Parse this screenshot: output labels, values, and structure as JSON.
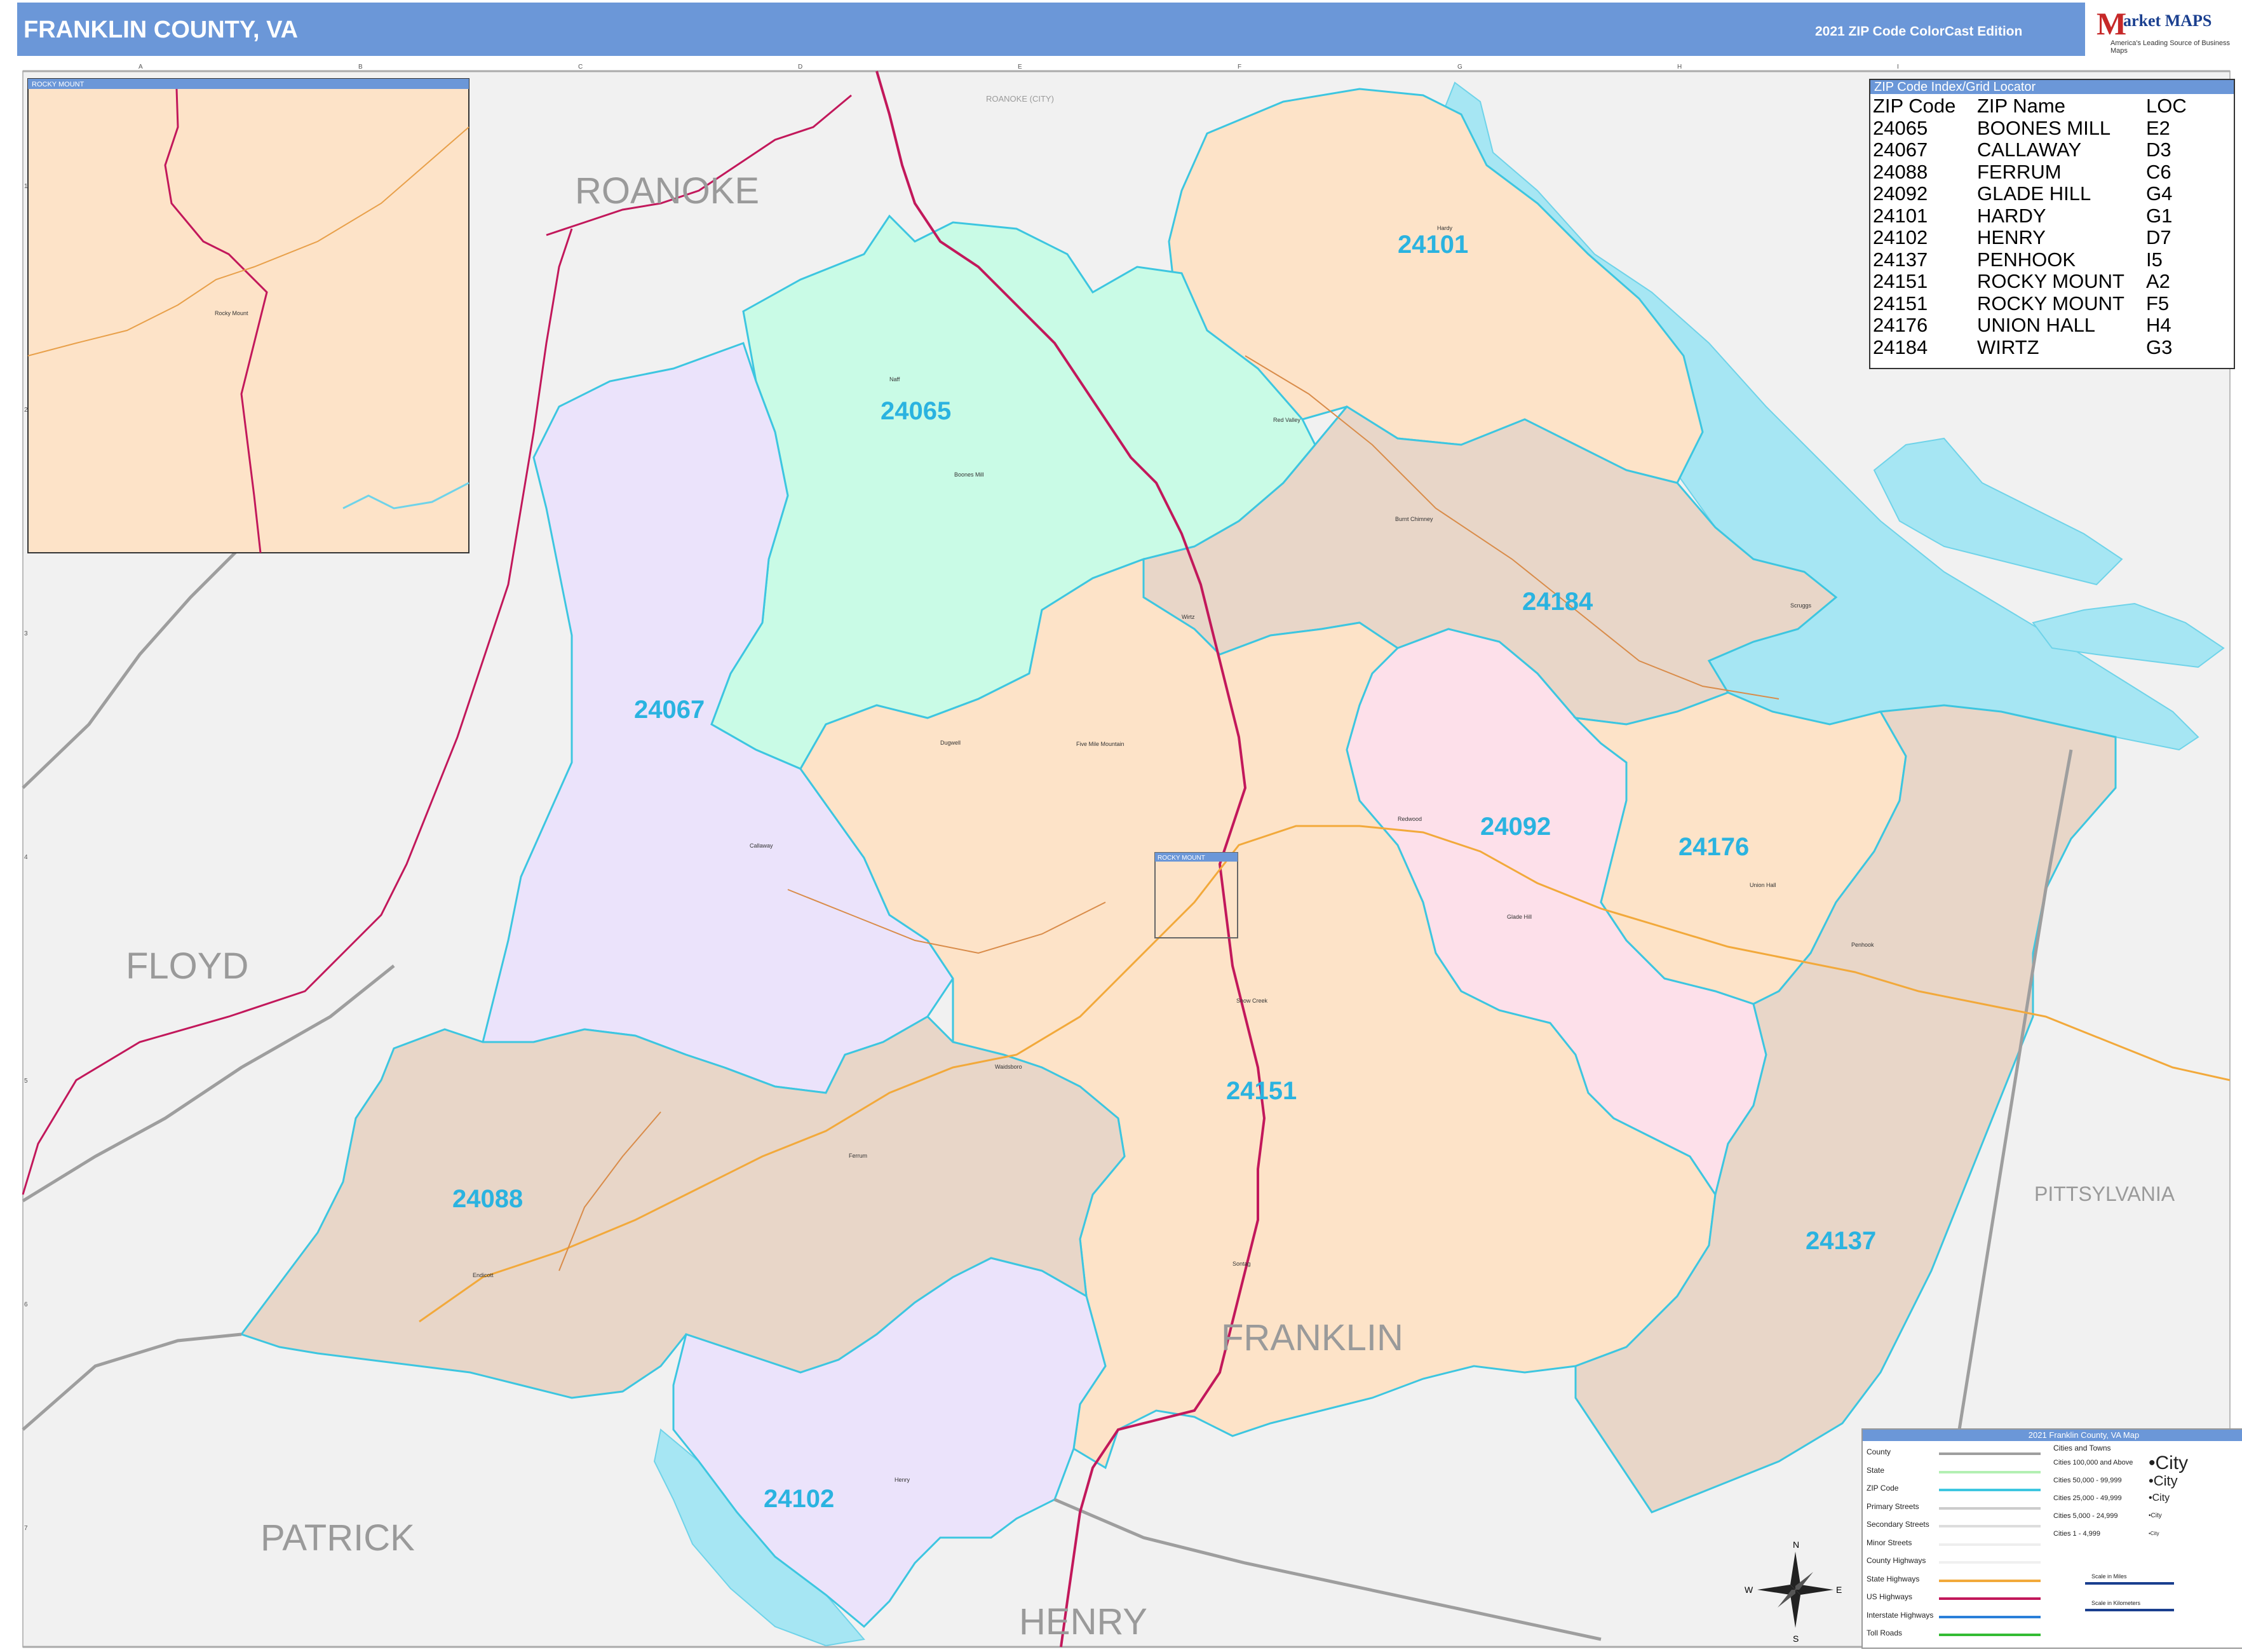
{
  "header": {
    "title": "FRANKLIN COUNTY, VA",
    "edition": "2021 ZIP Code ColorCast Edition",
    "logo": {
      "name": "Market MAPS",
      "m_letter": "M",
      "text": "arket MAPS",
      "tagline": "America's Leading Source of Business Maps"
    }
  },
  "grid": {
    "columns": [
      "A",
      "B",
      "C",
      "D",
      "E",
      "F",
      "G",
      "H",
      "I"
    ],
    "rows": [
      "1",
      "2",
      "3",
      "4",
      "5",
      "6",
      "7"
    ]
  },
  "regions": {
    "roanoke": "ROANOKE",
    "roanoke_city": "ROANOKE (CITY)",
    "floyd": "FLOYD",
    "patrick": "PATRICK",
    "henry": "HENRY",
    "pittsylvania": "PITTSYLVANIA",
    "franklin": "FRANKLIN"
  },
  "zips": {
    "z24065": "24065",
    "z24101": "24101",
    "z24067": "24067",
    "z24184": "24184",
    "z24092": "24092",
    "z24176": "24176",
    "z24151": "24151",
    "z24088": "24088",
    "z24137": "24137",
    "z24102": "24102"
  },
  "places": {
    "boones_mill": "Boones Mill",
    "hardy": "Hardy",
    "burnt_chimney": "Burnt Chimney",
    "wirtz": "Wirtz",
    "scruggs": "Scruggs",
    "glade_hill": "Glade Hill",
    "union_hall": "Union Hall",
    "penhook": "Penhook",
    "callaway": "Callaway",
    "ferrum": "Ferrum",
    "henry_town": "Henry",
    "sontag": "Sontag",
    "snow_creek": "Snow Creek",
    "redwood": "Redwood",
    "red_valley": "Red Valley",
    "waidsboro": "Waidsboro",
    "endicott": "Endicott",
    "dugspur": "Dugwell",
    "boones_top": "Naff",
    "five_mile": "Five Mile Mountain"
  },
  "zoom_inset": {
    "label": "ROCKY MOUNT",
    "place": "Rocky Mount",
    "locator_label": "ROCKY MOUNT"
  },
  "zip_index": {
    "title": "ZIP Code Index/Grid Locator",
    "headers": [
      "ZIP Code",
      "ZIP Name",
      "LOC"
    ],
    "rows": [
      [
        "24065",
        "BOONES MILL",
        "E2"
      ],
      [
        "24067",
        "CALLAWAY",
        "D3"
      ],
      [
        "24088",
        "FERRUM",
        "C6"
      ],
      [
        "24092",
        "GLADE HILL",
        "G4"
      ],
      [
        "24101",
        "HARDY",
        "G1"
      ],
      [
        "24102",
        "HENRY",
        "D7"
      ],
      [
        "24137",
        "PENHOOK",
        "I5"
      ],
      [
        "24151",
        "ROCKY MOUNT",
        "A2"
      ],
      [
        "24151",
        "ROCKY MOUNT",
        "F5"
      ],
      [
        "24176",
        "UNION HALL",
        "H4"
      ],
      [
        "24184",
        "WIRTZ",
        "G3"
      ]
    ]
  },
  "legend": {
    "title": "2021 Franklin County, VA Map",
    "left_items": [
      "County",
      "State",
      "ZIP Code",
      "Primary Streets",
      "Secondary Streets",
      "Minor Streets",
      "County Highways",
      "State Highways",
      "US Highways",
      "Interstate Highways",
      "Toll Roads"
    ],
    "cities_heading": "Cities and Towns",
    "cities": [
      [
        "Cities 100,000 and Above",
        "City"
      ],
      [
        "Cities 50,000 - 99,999",
        "City"
      ],
      [
        "Cities 25,000 - 49,999",
        "City"
      ],
      [
        "Cities 5,000 - 24,999",
        "City"
      ],
      [
        "Cities 1 - 4,999",
        "City"
      ]
    ],
    "scale_miles": "Scale in Miles",
    "scale_km": "Scale in Kilometers",
    "compass": {
      "n": "N",
      "s": "S",
      "e": "E",
      "w": "W"
    },
    "colors": {
      "zip_orange": "#fde3c8",
      "zip_green": "#c9fbe6",
      "zip_brown": "#e8d6c8",
      "zip_purple": "#ebe3fb",
      "zip_pink": "#fde0ea",
      "zip_border": "#3dc6e0",
      "water": "#a6e6f3",
      "us_highway": "#c2185b",
      "label_blue": "#2ab3e0"
    }
  }
}
